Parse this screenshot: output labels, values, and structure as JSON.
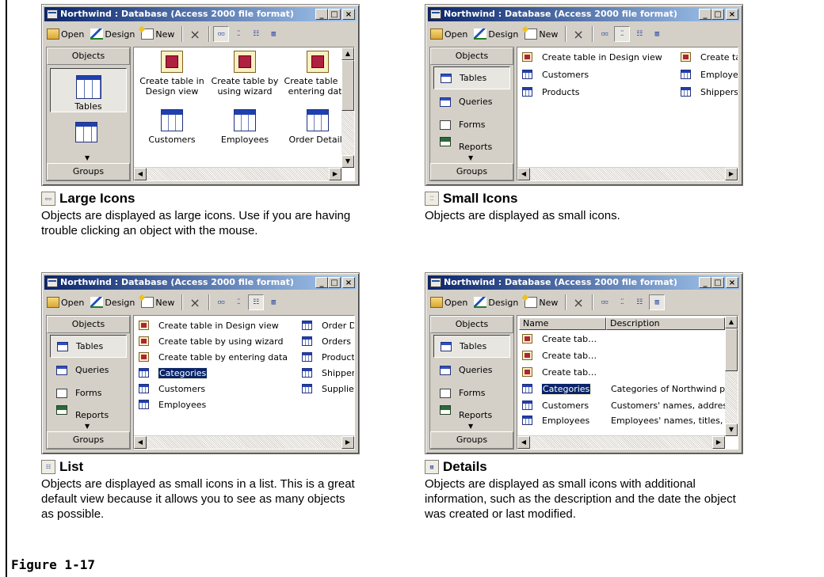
{
  "window": {
    "title": "Northwind : Database (Access 2000 file format)",
    "min": "_",
    "max": "□",
    "close": "×"
  },
  "toolbar": {
    "open": "Open",
    "design": "Design",
    "new": "New",
    "delete": "×"
  },
  "objects_bar": {
    "header": "Objects",
    "groups": "Groups",
    "items": [
      "Tables",
      "Queries",
      "Forms",
      "Reports"
    ]
  },
  "large_icons": {
    "items": [
      "Create table in Design view",
      "Create table by using wizard",
      "Create table by entering data",
      "Customers",
      "Employees",
      "Order Details"
    ],
    "caption_title": "Large Icons",
    "caption_text": "Objects are displayed as large icons. Use if you are having trouble clicking an object with the mouse."
  },
  "small_icons": {
    "col1": [
      "Create table in Design view",
      "Customers",
      "Products"
    ],
    "col2": [
      "Create ta",
      "Employee",
      "Shippers"
    ],
    "caption_title": "Small Icons",
    "caption_text": "Objects are displayed as small icons."
  },
  "list": {
    "col1": [
      "Create table in Design view",
      "Create table by using wizard",
      "Create table by entering data",
      "Categories",
      "Customers",
      "Employees"
    ],
    "col2": [
      "Order De",
      "Orders",
      "Products",
      "Shippers",
      "Suppliers"
    ],
    "caption_title": "List",
    "caption_text": "Objects are displayed as small icons in a list. This is a great default view because it allows you to see as many objects as possible."
  },
  "details": {
    "headers": [
      "Name",
      "Description"
    ],
    "rows": [
      {
        "name": "Create tab…",
        "desc": ""
      },
      {
        "name": "Create tab…",
        "desc": ""
      },
      {
        "name": "Create tab…",
        "desc": ""
      },
      {
        "name": "Categories",
        "desc": "Categories of Northwind prod"
      },
      {
        "name": "Customers",
        "desc": "Customers' names, addresses"
      },
      {
        "name": "Employees",
        "desc": "Employees' names, titles, an"
      }
    ],
    "caption_title": "Details",
    "caption_text": "Objects are displayed as small icons with additional information, such as the description and the date the object was created or last modified."
  },
  "figure_label": "Figure 1-17"
}
